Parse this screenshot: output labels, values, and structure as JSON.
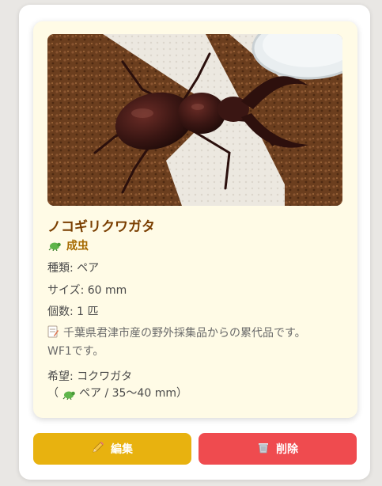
{
  "card": {
    "name": "ノコギリクワガタ",
    "stage": "成虫",
    "type_text": "種類: ペア",
    "size_text": "サイズ: 60 mm",
    "count_text": "個数: 1 匹",
    "memo_line1": "千葉県君津市産の野外採集品からの累代品です。",
    "memo_line2": "WF1です。",
    "want_line1": "希望: コクワガタ",
    "want_open": "（",
    "want_detail": "ペア / 35〜40 mm）"
  },
  "actions": {
    "edit_label": "編集",
    "delete_label": "削除"
  },
  "icons": {
    "stage": "beetle-icon",
    "memo": "memo-icon",
    "want": "beetle-icon",
    "edit": "pencil-icon",
    "delete": "wastebasket-icon"
  },
  "colors": {
    "title": "#7a3e00",
    "stage": "#a66a00",
    "card_bg": "#fffbe6",
    "edit_button": "#e8b20f",
    "delete_button": "#ef4b4f"
  }
}
